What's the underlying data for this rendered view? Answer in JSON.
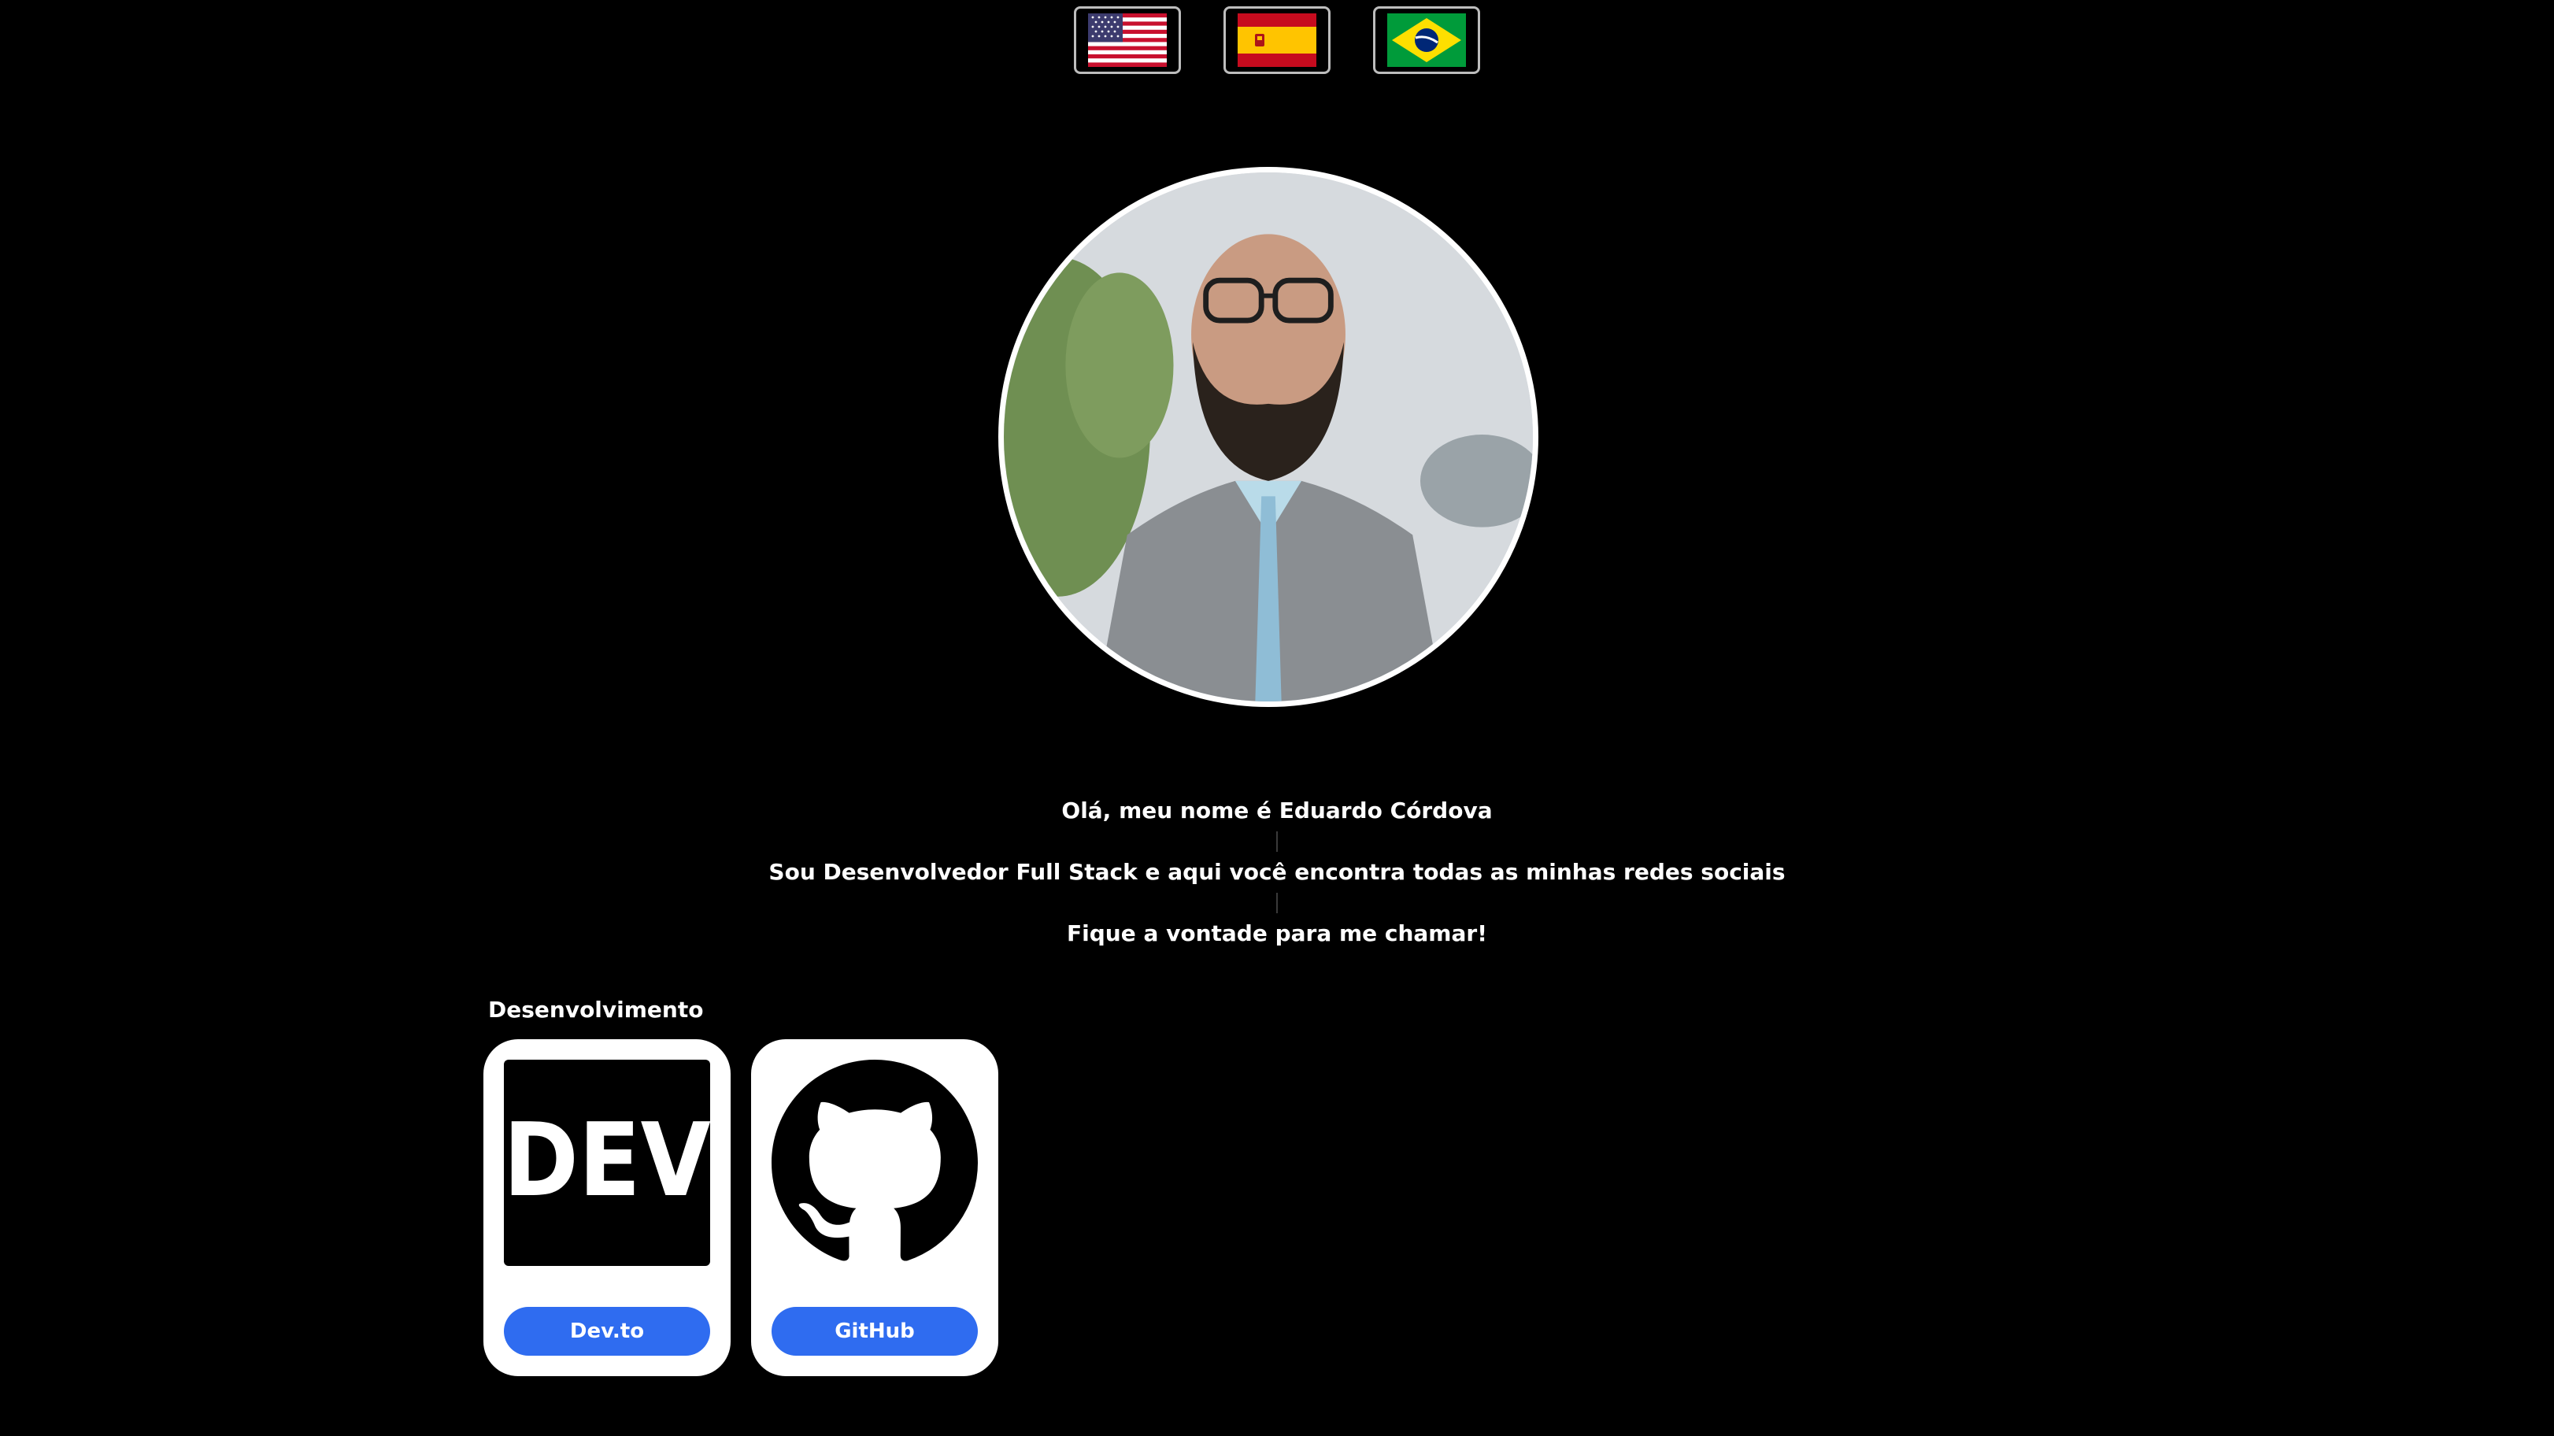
{
  "language_flags": [
    {
      "icon": "us-flag-icon",
      "country": "United States"
    },
    {
      "icon": "spain-flag-icon",
      "country": "Spain"
    },
    {
      "icon": "brazil-flag-icon",
      "country": "Brazil"
    }
  ],
  "profile": {
    "avatar_icon": "profile-photo"
  },
  "intro": {
    "line1": "Olá, meu nome é Eduardo Córdova",
    "line2": "Sou Desenvolvedor Full Stack e aqui você encontra todas as minhas redes sociais",
    "line3": "Fique a vontade para me chamar!"
  },
  "sections": [
    {
      "title": "Desenvolvimento",
      "links": [
        {
          "label": "Dev.to",
          "icon": "dev-to-logo-icon",
          "logo_text": "DEV"
        },
        {
          "label": "GitHub",
          "icon": "github-logo-icon"
        }
      ]
    }
  ],
  "colors": {
    "background": "#000000",
    "button": "#2f6cf0",
    "card": "#ffffff",
    "text": "#ffffff"
  }
}
